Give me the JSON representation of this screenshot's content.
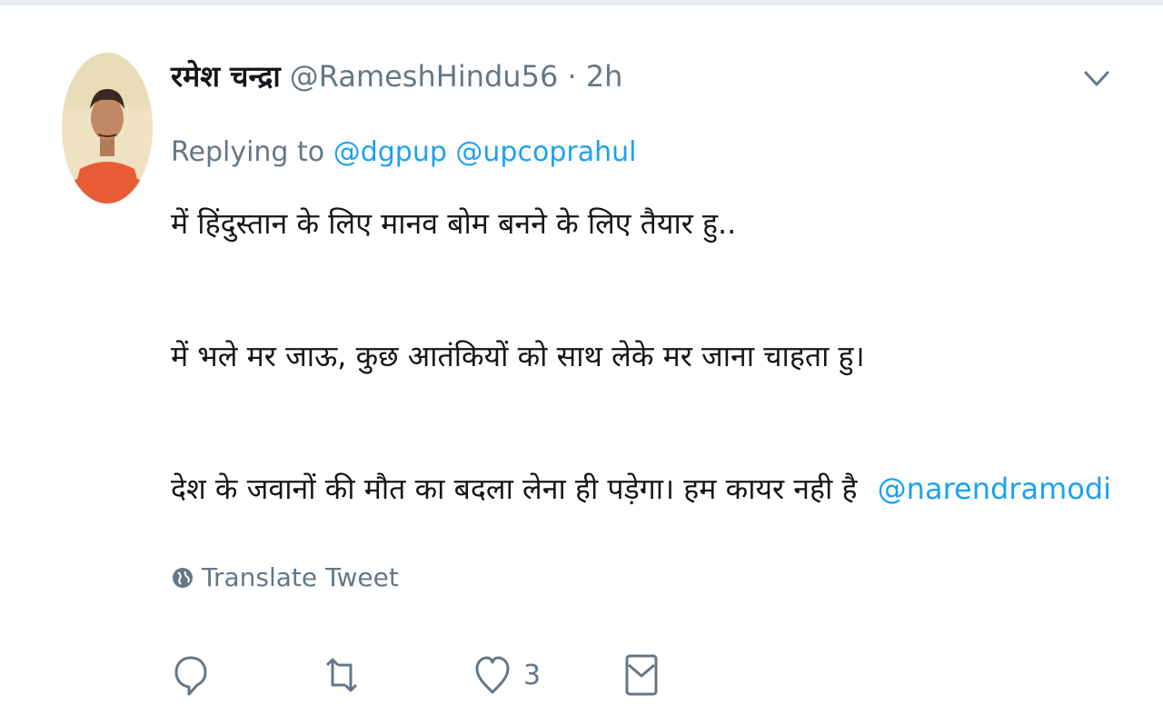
{
  "tweet": {
    "author": {
      "name": "रमेश चन्द्रा",
      "handle": "@RameshHindu56",
      "separator": "·",
      "time": "2h"
    },
    "replying": {
      "prefix": "Replying to",
      "mentions": [
        "@dgpup",
        "@upcoprahul"
      ]
    },
    "body": {
      "line1": "में हिंदुस्तान के लिए मानव बोम बनने के लिए तैयार हु..",
      "line2": "में भले मर जाऊ, कुछ आतंकियों को साथ लेके मर जाना चाहता हु।",
      "line3_text": "देश के जवानों की मौत का बदला लेना ही पड़ेगा। हम कायर नही है",
      "line3_mention": "@narendramodi"
    },
    "translate_label": "Translate Tweet",
    "actions": {
      "reply_icon": "reply-icon",
      "retweet_icon": "retweet-icon",
      "like_icon": "heart-icon",
      "like_count": "3",
      "dm_icon": "envelope-icon"
    },
    "colors": {
      "link": "#1da1f2",
      "muted": "#657786",
      "text": "#14171a"
    }
  }
}
